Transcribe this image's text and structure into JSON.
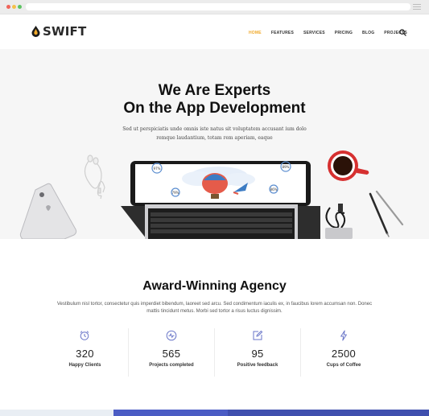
{
  "brand": {
    "name": "SWIFT",
    "accent": "#f0a92a"
  },
  "nav": {
    "items": [
      {
        "label": "HOME",
        "active": true
      },
      {
        "label": "FEATURES",
        "active": false
      },
      {
        "label": "SERVICES",
        "active": false
      },
      {
        "label": "PRICING",
        "active": false
      },
      {
        "label": "BLOG",
        "active": false
      },
      {
        "label": "PROJECTS",
        "active": false
      }
    ],
    "search_icon": "search-icon"
  },
  "hero": {
    "title_line1": "We Are Experts",
    "title_line2": "On the App Development",
    "subtitle_line1": "Sed ut perspiciatis unde omnis iste natus sit voluptatem accusant ium dolo",
    "subtitle_line2": "remque laudantium, totam rem aperiam, eaque",
    "screen_badges": [
      "97%",
      "89%",
      "79%",
      "86%"
    ]
  },
  "agency": {
    "title": "Award-Winning Agency",
    "desc_line1": "Vestibulum nisl tortor, consectetur quis imperdiet bibendum, laoreet sed arcu. Sed condimentum iaculis ex, in faucibus lorem accumsan non. Donec",
    "desc_line2": "mattis tincidunt metus. Morbi sed tortor a risus luctus dignissim."
  },
  "stats": [
    {
      "value": "320",
      "label": "Happy Clients",
      "icon": "alarm-clock-icon"
    },
    {
      "value": "565",
      "label": "Projects completed",
      "icon": "activity-icon"
    },
    {
      "value": "95",
      "label": "Positive feedback",
      "icon": "edit-icon"
    },
    {
      "value": "2500",
      "label": "Cups of Coffee",
      "icon": "lightning-icon"
    }
  ],
  "colors": {
    "icon": "#6a76c8",
    "footer_a": "#e9eef4",
    "footer_b": "#4b5cc4",
    "footer_c": "#3f4fae"
  }
}
